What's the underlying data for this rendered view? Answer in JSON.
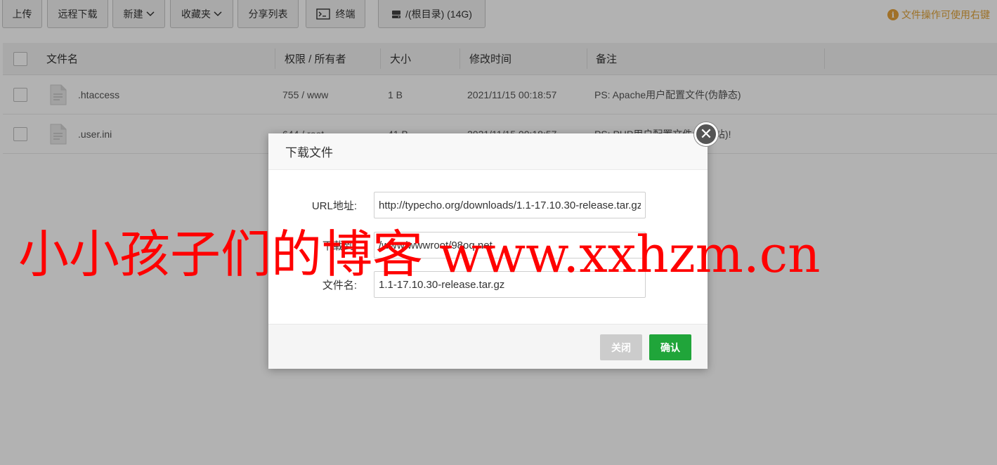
{
  "toolbar": {
    "upload": "上传",
    "remote_download": "远程下载",
    "new": "新建",
    "favorites": "收藏夹",
    "share_list": "分享列表",
    "terminal": "终端",
    "path": "/(根目录) (14G)",
    "hint": "文件操作可使用右键"
  },
  "table": {
    "headers": {
      "name": "文件名",
      "perm": "权限 / 所有者",
      "size": "大小",
      "mtime": "修改时间",
      "note": "备注"
    },
    "rows": [
      {
        "name": ".htaccess",
        "perm": "755 / www",
        "size": "1 B",
        "mtime": "2021/11/15 00:18:57",
        "note": "PS: Apache用户配置文件(伪静态)"
      },
      {
        "name": ".user.ini",
        "perm": "644 / root",
        "size": "41 B",
        "mtime": "2021/11/15 00:18:57",
        "note": "PS: PHP用户配置文件(防跨站)!"
      }
    ]
  },
  "dialog": {
    "title": "下载文件",
    "url_label": "URL地址:",
    "url_value": "http://typecho.org/downloads/1.1-17.10.30-release.tar.gz",
    "dest_label": "下载到:",
    "dest_value": "/www/wwwroot/98oq.net",
    "filename_label": "文件名:",
    "filename_value": "1.1-17.10.30-release.tar.gz",
    "close_btn": "关闭",
    "ok_btn": "确认"
  },
  "watermark": "小小孩子们的博客 www.xxhzm.cn",
  "colors": {
    "accent_green": "#20a53a",
    "hint_orange": "#e6a23c",
    "watermark_red": "#ff0000"
  }
}
